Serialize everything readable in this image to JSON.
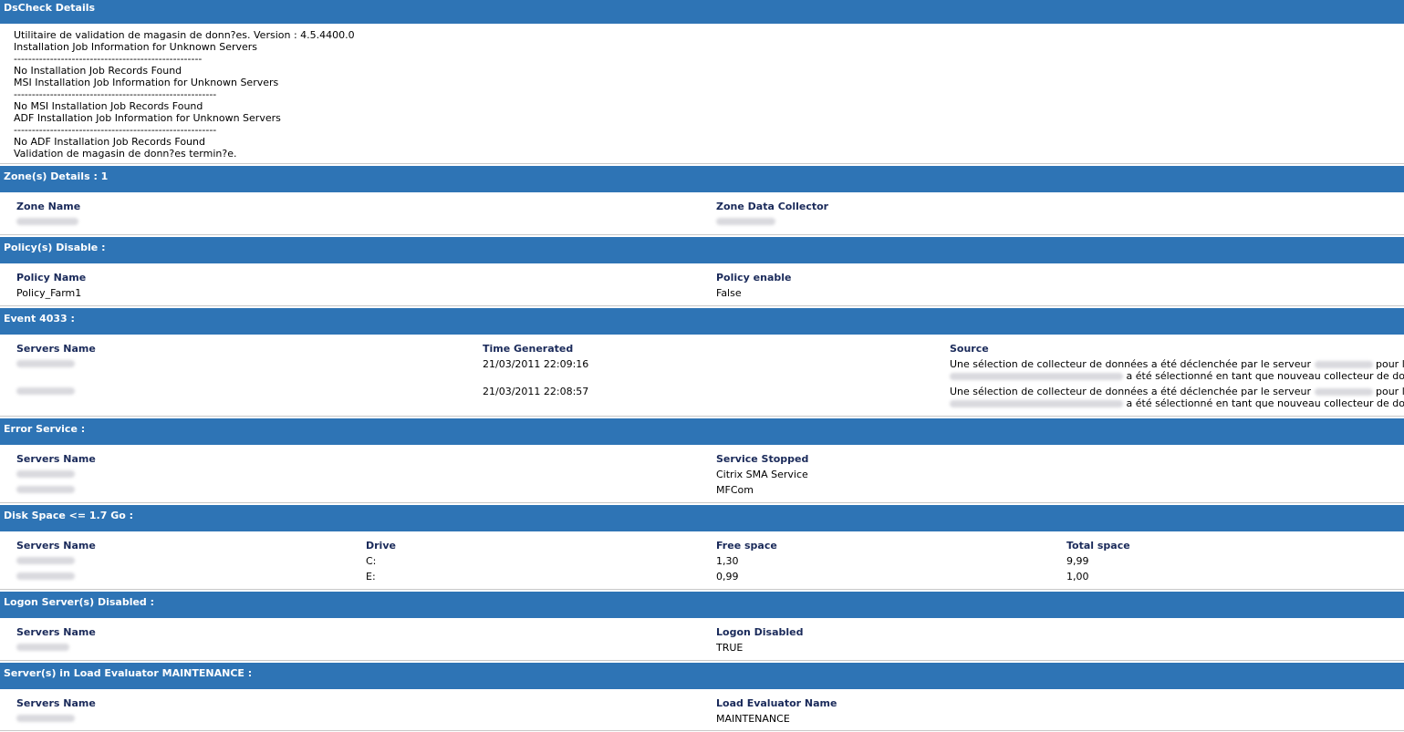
{
  "sections": {
    "dscheck": {
      "title": "DsCheck Details",
      "lines": [
        "Utilitaire de validation de magasin de donn?es. Version : 4.5.4400.0",
        "Installation Job Information for Unknown Servers",
        "----------------------------------------------------",
        "No Installation Job Records Found",
        "MSI Installation Job Information for Unknown Servers",
        "--------------------------------------------------------",
        "No MSI Installation Job Records Found",
        "ADF Installation Job Information for Unknown Servers",
        "--------------------------------------------------------",
        "No ADF Installation Job Records Found",
        "Validation de magasin de donn?es termin?e."
      ]
    },
    "zones": {
      "title": "Zone(s) Details : 1",
      "col_zone_name": "Zone Name",
      "col_zone_data_collector": "Zone Data Collector"
    },
    "policies": {
      "title": "Policy(s) Disable :",
      "col_policy_name": "Policy Name",
      "col_policy_enable": "Policy enable",
      "rows": [
        {
          "name": "Policy_Farm1",
          "enable": "False"
        }
      ]
    },
    "event4033": {
      "title": "Event 4033 :",
      "col_servers_name": "Servers Name",
      "col_time_generated": "Time Generated",
      "col_source": "Source",
      "rows": [
        {
          "time": "21/03/2011 22:09:16",
          "source_line1_a": "Une sélection de collecteur de données a été déclenchée par le serveur",
          "source_line1_b": "pour la zone",
          "source_line2": "a été sélectionné en tant que nouveau collecteur de données."
        },
        {
          "time": "21/03/2011 22:08:57",
          "source_line1_a": "Une sélection de collecteur de données a été déclenchée par le serveur",
          "source_line1_b": "pour la zone",
          "source_line2": "a été sélectionné en tant que nouveau collecteur de données."
        }
      ]
    },
    "error_service": {
      "title": "Error Service :",
      "col_servers_name": "Servers Name",
      "col_service_stopped": "Service Stopped",
      "rows": [
        {
          "service": "Citrix SMA Service"
        },
        {
          "service": "MFCom"
        }
      ]
    },
    "disk_space": {
      "title": "Disk Space <= 1.7 Go :",
      "col_servers_name": "Servers Name",
      "col_drive": "Drive",
      "col_free_space": "Free space",
      "col_total_space": "Total space",
      "rows": [
        {
          "drive": "C:",
          "free": "1,30",
          "total": "9,99"
        },
        {
          "drive": "E:",
          "free": "0,99",
          "total": "1,00"
        }
      ]
    },
    "logon_disabled": {
      "title": "Logon Server(s) Disabled :",
      "col_servers_name": "Servers Name",
      "col_logon_disabled": "Logon Disabled",
      "rows": [
        {
          "value": "TRUE"
        }
      ]
    },
    "load_evaluator": {
      "title": "Server(s) in Load Evaluator MAINTENANCE :",
      "col_servers_name": "Servers Name",
      "col_load_evaluator_name": "Load Evaluator Name",
      "rows": [
        {
          "value": "MAINTENANCE"
        }
      ]
    }
  }
}
